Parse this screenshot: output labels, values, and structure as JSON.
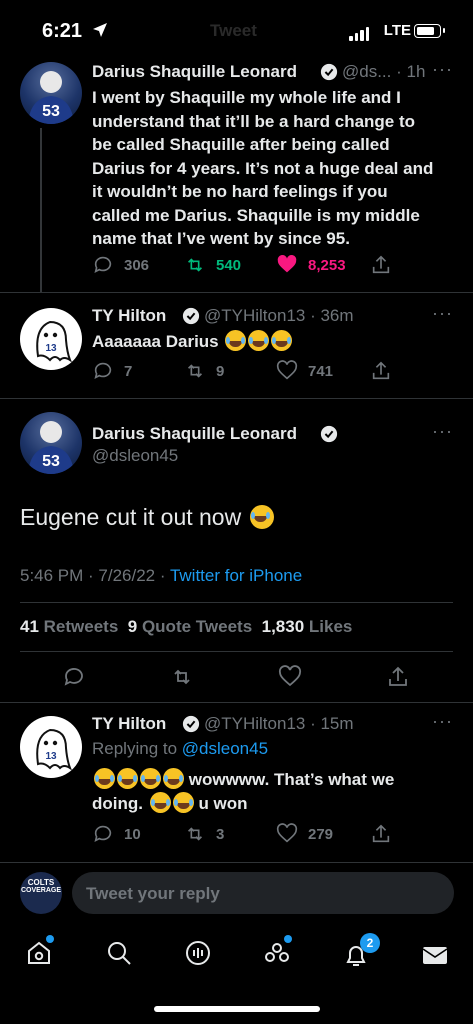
{
  "status": {
    "time": "6:21",
    "network": "LTE",
    "header_ghost": "Tweet"
  },
  "thread": {
    "parent": {
      "name": "Darius Shaquille Leonard",
      "handle_time": "@ds... · 1h",
      "text": "I went by Shaquille my whole life and I understand that it’ll be a hard change to be called Shaquille after being called Darius for 4 years. It’s not a huge deal and it wouldn’t be no hard feelings if you called me Darius. Shaquille is my middle name that I’ve went by since 95.",
      "replies": "306",
      "retweets": "540",
      "likes": "8,253",
      "jersey": "53"
    },
    "reply1": {
      "name": "TY Hilton",
      "handle_time": "@TYHilton13 · 36m",
      "text": "Aaaaaaa Darius",
      "replies": "7",
      "retweets": "9",
      "likes": "741",
      "jersey": "13"
    }
  },
  "main": {
    "name": "Darius Shaquille Leonard",
    "handle": "@dsleon45",
    "text": "Eugene cut it out now",
    "timestamp": "5:46 PM · 7/26/22 · ",
    "source": "Twitter for iPhone",
    "retweets_count": "41",
    "retweets_label": "Retweets",
    "quotes_count": "9",
    "quotes_label": "Quote Tweets",
    "likes_count": "1,830",
    "likes_label": "Likes"
  },
  "reply2": {
    "name": "TY Hilton",
    "handle_time": "@TYHilton13 · 15m",
    "replying_prefix": "Replying to ",
    "replying_handle": "@dsleon45",
    "text_line1": "wowwww. That’s what we",
    "text_line2_a": "doing.",
    "text_line2_b": "u won",
    "replies": "10",
    "retweets": "3",
    "likes": "279"
  },
  "composer": {
    "placeholder": "Tweet your reply",
    "avatar_text_1": "COLTS",
    "avatar_text_2": "COVERAGE"
  },
  "nav": {
    "notifications_badge": "2"
  },
  "colors": {
    "accent": "#1d9bf0",
    "retweet_green": "#00ba7c",
    "like_pink": "#f91880",
    "muted": "#71767b"
  }
}
